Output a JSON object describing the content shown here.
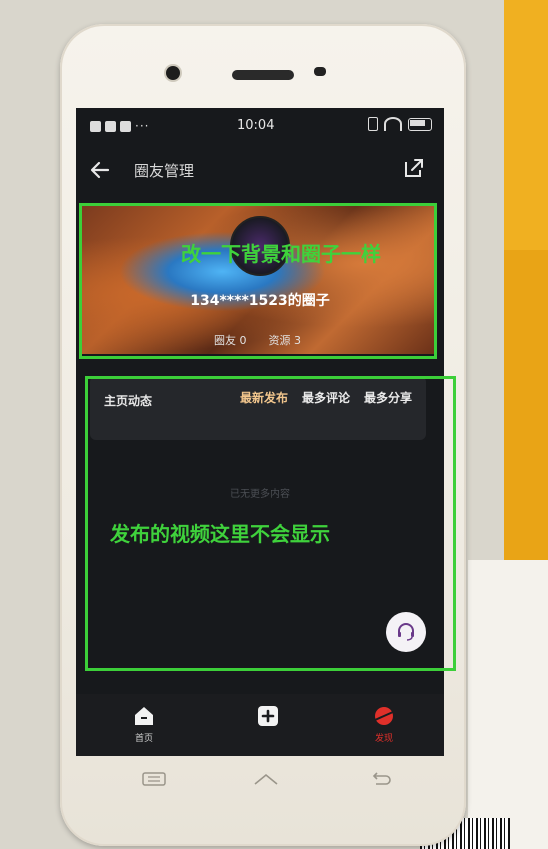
{
  "status": {
    "time": "10:04"
  },
  "nav": {
    "title": "圈友管理"
  },
  "circle": {
    "name": "134****1523的圈子",
    "members": "圈友 0",
    "resources": "资源 3"
  },
  "feed": {
    "section_title": "主页动态",
    "tabs": [
      {
        "label": "最新发布",
        "color": "#f2c68d"
      },
      {
        "label": "最多评论",
        "color": "#eaeaea"
      },
      {
        "label": "最多分享",
        "color": "#eaeaea"
      }
    ],
    "empty": "已无更多内容"
  },
  "bottom_nav": [
    {
      "label": "首页",
      "icon": "home-icon"
    },
    {
      "label": "",
      "icon": "plus-icon"
    },
    {
      "label": "发现",
      "icon": "planet-icon",
      "color": "#e0302a"
    }
  ],
  "annotations": {
    "top": "改一下背景和圈子一样",
    "middle": "发布的视频这里不会显示"
  }
}
